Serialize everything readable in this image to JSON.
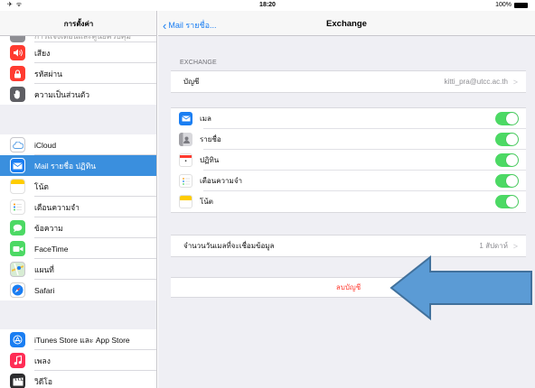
{
  "status": {
    "left": "✈ ᯤ",
    "time": "18:20",
    "battery": "100%"
  },
  "sidebar": {
    "title": "การตั้งค่า",
    "partial_item": "การแจ้งเตือนและศูนย์ควบคุม",
    "items_a": [
      {
        "label": "เสียง",
        "icon": "speaker-icon",
        "color": "#ff3b30"
      },
      {
        "label": "รหัสผ่าน",
        "icon": "lock-icon",
        "color": "#ff3b30"
      },
      {
        "label": "ความเป็นส่วนตัว",
        "icon": "hand-icon",
        "color": "#5e5e63"
      }
    ],
    "items_b": [
      {
        "label": "iCloud",
        "icon": "cloud-icon",
        "color": "#8e8e93"
      },
      {
        "label": "Mail รายชื่อ ปฏิทิน",
        "icon": "mail-icon",
        "color": "#1a7ef2"
      },
      {
        "label": "โน้ต",
        "icon": "notes-icon",
        "color": "#ffcc00"
      },
      {
        "label": "เตือนความจำ",
        "icon": "reminders-icon",
        "color": "#ffffff"
      },
      {
        "label": "ข้อความ",
        "icon": "message-icon",
        "color": "#4cd964"
      },
      {
        "label": "FaceTime",
        "icon": "video-icon",
        "color": "#4cd964"
      },
      {
        "label": "แผนที่",
        "icon": "map-icon",
        "color": "#7fc8a9"
      },
      {
        "label": "Safari",
        "icon": "compass-icon",
        "color": "#1a7ef2"
      }
    ],
    "items_c": [
      {
        "label": "iTunes Store และ App Store",
        "icon": "app-store-icon",
        "color": "#1a7ef2"
      },
      {
        "label": "เพลง",
        "icon": "music-icon",
        "color": "#ff2d55"
      },
      {
        "label": "วิดีโอ",
        "icon": "clapper-icon",
        "color": "#2c2c2e"
      }
    ]
  },
  "navbar": {
    "back_label": "Mail รายชื่อ...",
    "title": "Exchange"
  },
  "detail": {
    "section_header": "EXCHANGE",
    "account": {
      "label": "บัญชี",
      "value": "kitti_pra@utcc.ac.th"
    },
    "sync_items": [
      {
        "label": "เมล",
        "icon": "mail-icon",
        "color": "#1a7ef2",
        "on": true
      },
      {
        "label": "รายชื่อ",
        "icon": "contacts-icon",
        "color": "#8e8e93",
        "on": true
      },
      {
        "label": "ปฏิทิน",
        "icon": "calendar-icon",
        "color": "#ffffff",
        "on": true
      },
      {
        "label": "เตือนความจำ",
        "icon": "reminders-icon",
        "color": "#ffffff",
        "on": true
      },
      {
        "label": "โน้ต",
        "icon": "notes-icon",
        "color": "#ffcc00",
        "on": true
      }
    ],
    "mail_days": {
      "label": "จำนวนวันเมลที่จะเชื่อมข้อมูล",
      "value": "1 สัปดาห์"
    },
    "delete_label": "ลบบัญชี"
  },
  "colors": {
    "accent": "#1a7ef2",
    "selected_row": "#3a8fde",
    "toggle_on": "#4cd964",
    "destructive": "#ff3b30",
    "annotation_arrow": "#5b9bd5"
  }
}
